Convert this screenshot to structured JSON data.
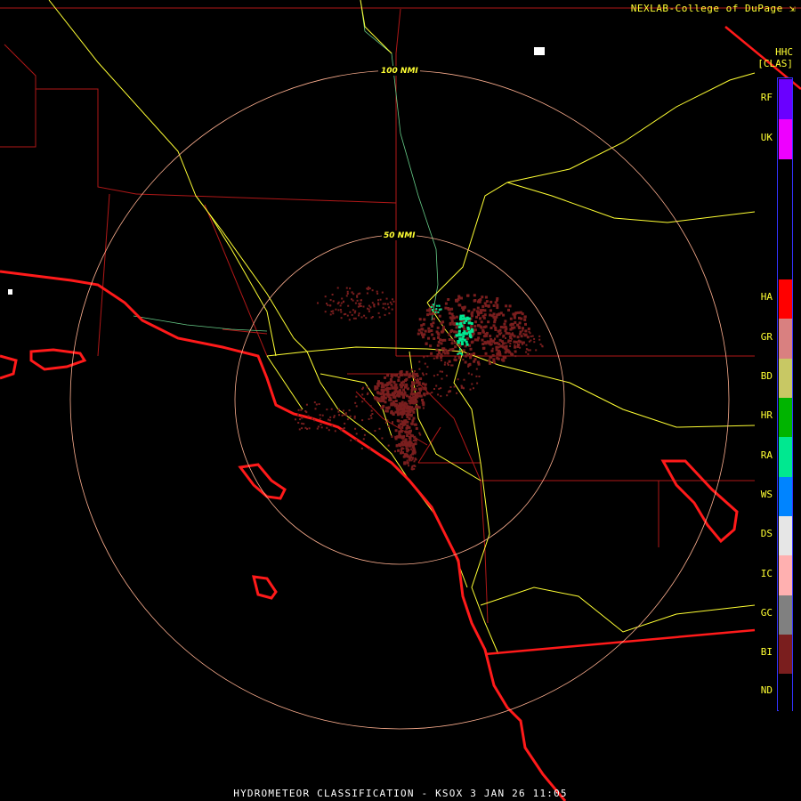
{
  "header": {
    "credit": "NEXLAB-College of DuPage",
    "product_code": "HHC",
    "product_group": "[CLAS]"
  },
  "rings": [
    {
      "label": "100 NMI"
    },
    {
      "label": "50 NMI"
    }
  ],
  "legend": [
    {
      "code": "RF",
      "color": "#6a00ff"
    },
    {
      "code": "UK",
      "color": "#ee00ff"
    },
    {
      "code": "HA",
      "color": "#ff0000"
    },
    {
      "code": "GR",
      "color": "#d98080"
    },
    {
      "code": "BD",
      "color": "#c8c864"
    },
    {
      "code": "HR",
      "color": "#00b400"
    },
    {
      "code": "RA",
      "color": "#00e890"
    },
    {
      "code": "WS",
      "color": "#0084ff"
    },
    {
      "code": "DS",
      "color": "#e6e6e6"
    },
    {
      "code": "IC",
      "color": "#ffb0b0"
    },
    {
      "code": "GC",
      "color": "#808080"
    },
    {
      "code": "BI",
      "color": "#7a1e1e"
    },
    {
      "code": "ND",
      "color": "#000000"
    }
  ],
  "footer": {
    "title": "HYDROMETEOR CLASSIFICATION - KSOX 3 JAN 26 11:05"
  },
  "colors": {
    "coast": "#ff1a1a",
    "county": "#b01818",
    "highway": "#ffff33",
    "river": "#66cc88",
    "ring": "#ffb090"
  }
}
